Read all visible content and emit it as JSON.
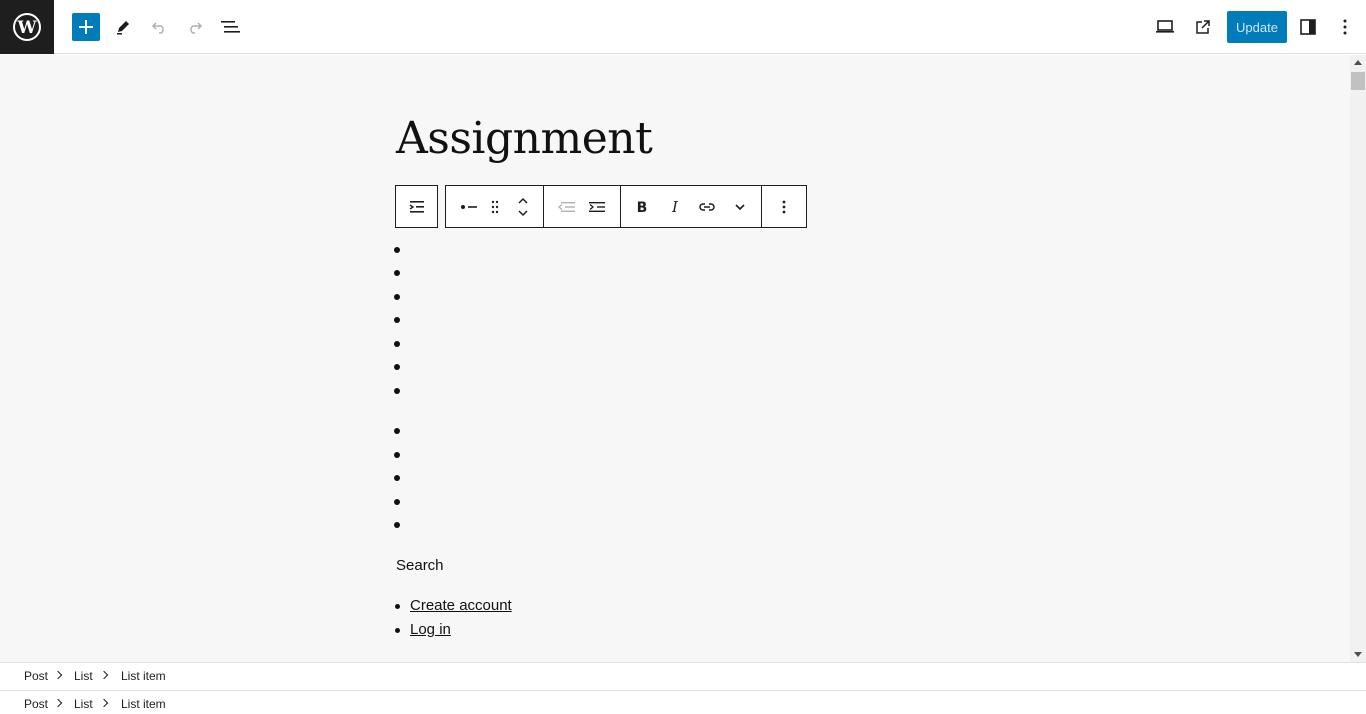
{
  "toolbar": {
    "update_label": "Update"
  },
  "post": {
    "title": "Assignment"
  },
  "content": {
    "search_label": "Search",
    "links": [
      "Create account",
      "Log in"
    ]
  },
  "breadcrumb": {
    "items": [
      "Post",
      "List",
      "List item"
    ]
  },
  "colors": {
    "accent": "#007cba",
    "canvas": "#f7f7f7",
    "logo_bg": "#1e1e1e"
  },
  "icons": {
    "topbar": [
      "wordpress-logo-icon",
      "plus-icon",
      "pencil-icon",
      "undo-icon",
      "redo-icon",
      "list-view-icon",
      "desktop-preview-icon",
      "external-link-icon",
      "sidebar-toggle-icon",
      "more-vertical-icon"
    ],
    "block_toolbar": [
      "select-parent-list-icon",
      "list-item-icon",
      "drag-handle-icon",
      "move-up-down-icon",
      "outdent-icon",
      "indent-icon",
      "bold-icon",
      "italic-icon",
      "link-icon",
      "chevron-down-icon",
      "more-vertical-icon"
    ]
  }
}
